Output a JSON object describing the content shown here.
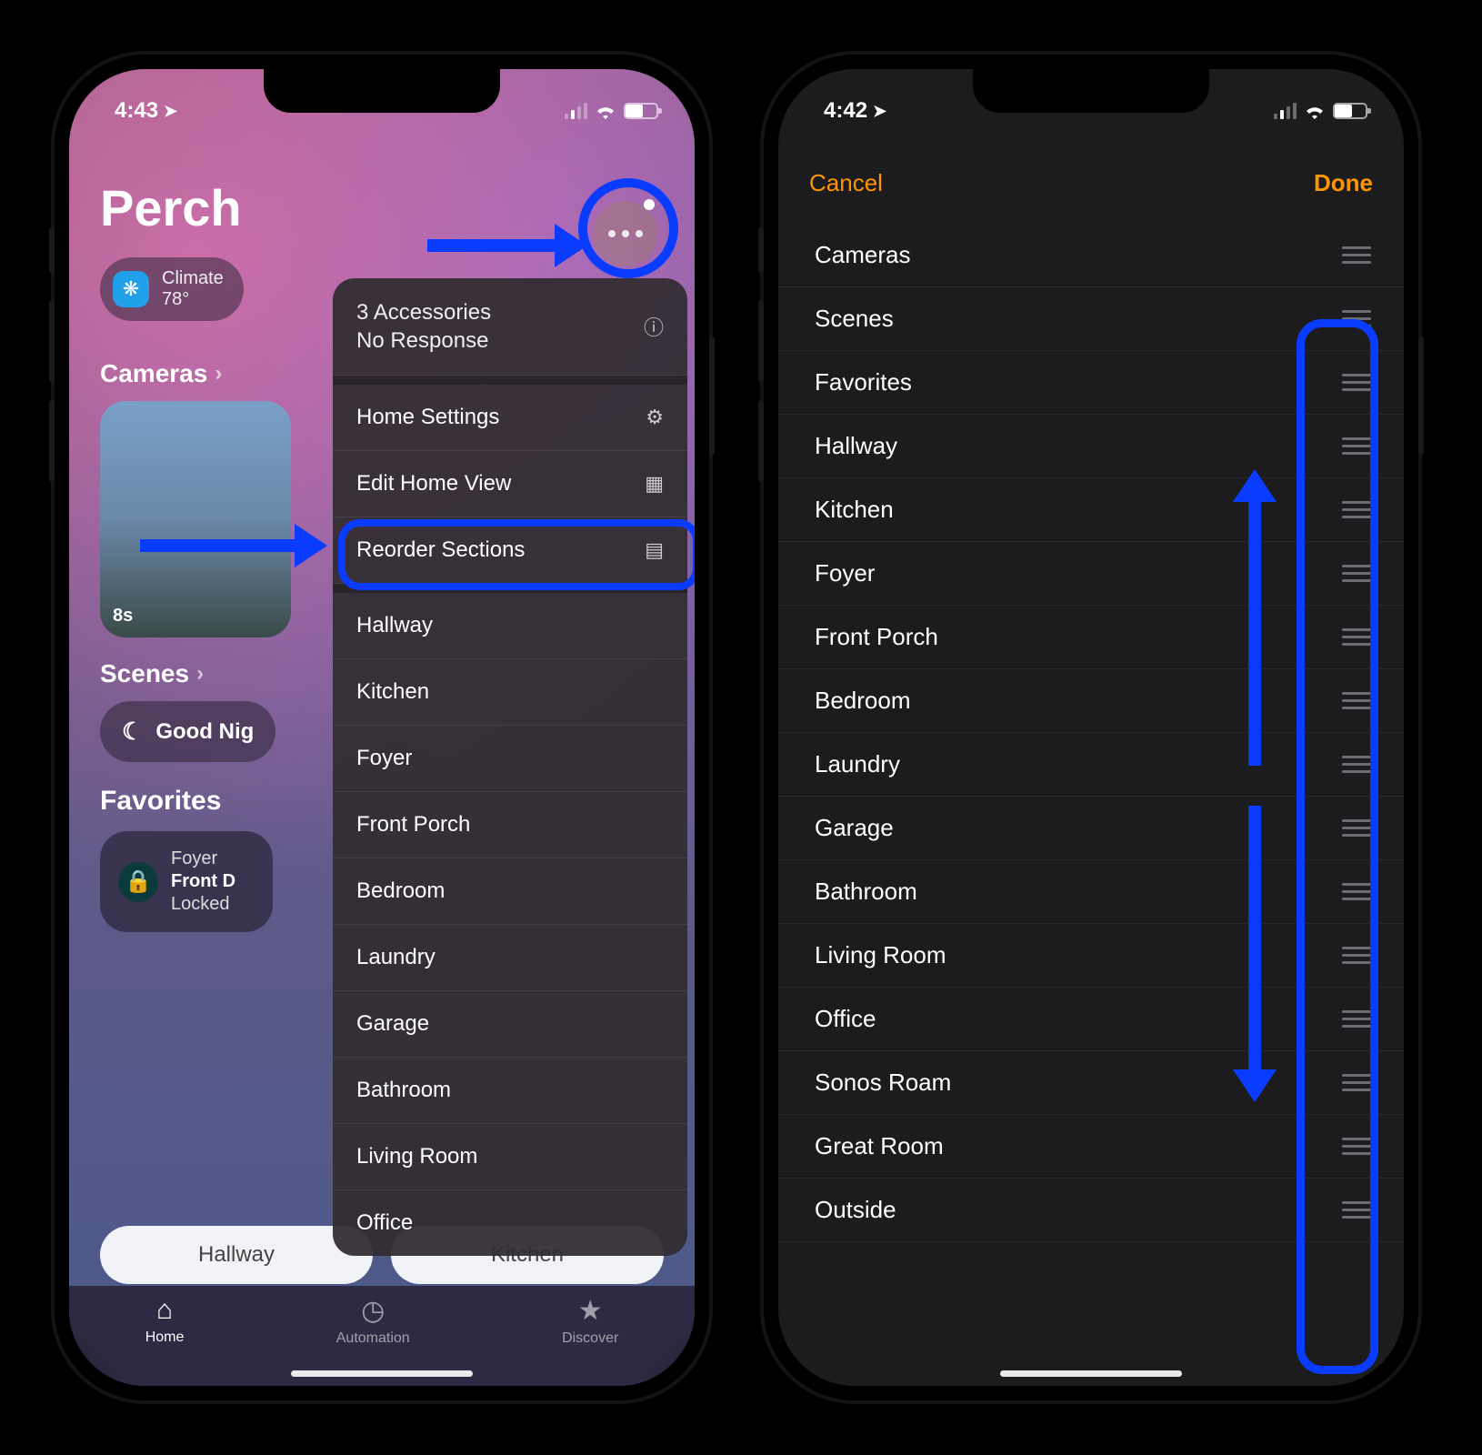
{
  "left": {
    "status": {
      "time": "4:43",
      "location_arrow": "➤"
    },
    "home_name": "Perch",
    "climate": {
      "label": "Climate",
      "temp": "78°"
    },
    "sections": {
      "cameras": {
        "title": "Cameras",
        "thumb_ts": "8s"
      },
      "scenes": {
        "title": "Scenes",
        "scene_name": "Good Nig"
      },
      "favorites": {
        "title": "Favorites",
        "card": {
          "room": "Foyer",
          "name": "Front D",
          "state": "Locked"
        }
      }
    },
    "room_pills": [
      "Hallway",
      "Kitchen"
    ],
    "tabs": {
      "home": "Home",
      "automation": "Automation",
      "discover": "Discover"
    },
    "menu": {
      "status_line1": "3 Accessories",
      "status_line2": "No Response",
      "home_settings": "Home Settings",
      "edit_home_view": "Edit Home View",
      "reorder_sections": "Reorder Sections",
      "rooms": [
        "Hallway",
        "Kitchen",
        "Foyer",
        "Front Porch",
        "Bedroom",
        "Laundry",
        "Garage",
        "Bathroom",
        "Living Room",
        "Office"
      ]
    }
  },
  "right": {
    "status": {
      "time": "4:42",
      "location_arrow": "➤"
    },
    "nav": {
      "cancel": "Cancel",
      "done": "Done"
    },
    "items": [
      "Cameras",
      "Scenes",
      "Favorites",
      "Hallway",
      "Kitchen",
      "Foyer",
      "Front Porch",
      "Bedroom",
      "Laundry",
      "Garage",
      "Bathroom",
      "Living Room",
      "Office",
      "Sonos Roam",
      "Great Room",
      "Outside"
    ]
  }
}
